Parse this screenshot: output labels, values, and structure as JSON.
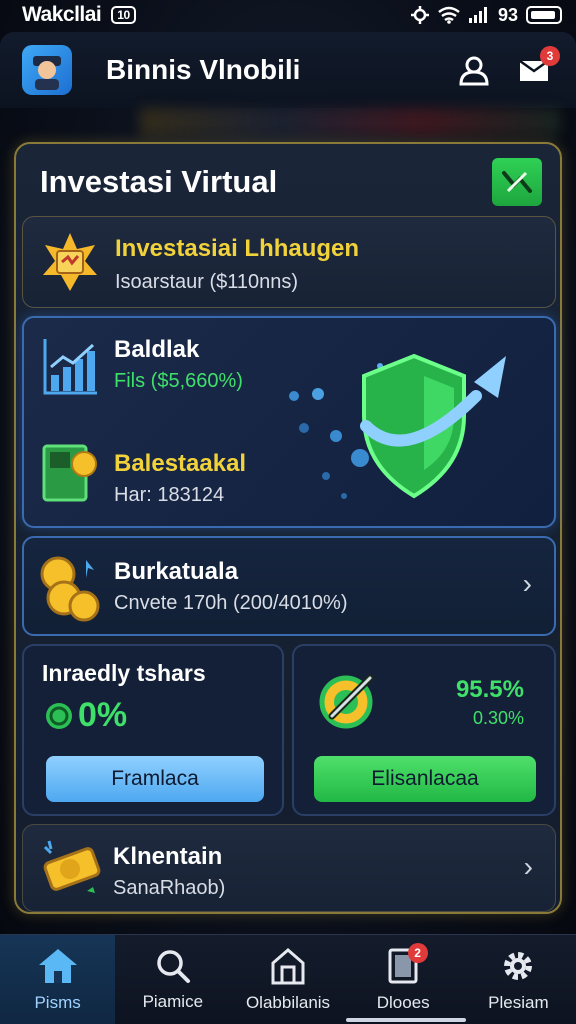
{
  "status": {
    "carrier": "Wakcllai",
    "pill": "10",
    "time": "93",
    "signal": "signal-icon",
    "wifi": "wifi-icon"
  },
  "header": {
    "title": "Binnis Vlnobili",
    "notification_count": "3"
  },
  "panel": {
    "title": "Investasi Virtual",
    "cards": {
      "info": {
        "title": "Investasiai Lhhaugen",
        "subtitle": "Isoarstaur ($110nns)"
      },
      "balance": {
        "title": "Baldlak",
        "value": "Fils ($5,660%)",
        "title2": "Balestaakal",
        "value2": "Har: 183124"
      },
      "earnings": {
        "title": "Burkatuala",
        "subtitle": "Cnvete 170h (200/4010%)"
      },
      "stats": {
        "title": "Inraedly tshars",
        "percent": "0%",
        "button": "Framlaca"
      },
      "growth": {
        "percent_main": "95.5%",
        "percent_sub": "0.30%",
        "button": "Elisanlacaa"
      },
      "extra": {
        "title": "Klnentain",
        "subtitle": "SanaRhaob)"
      }
    }
  },
  "nav": [
    {
      "label": "Pisms",
      "icon": "home-icon"
    },
    {
      "label": "Piamice",
      "icon": "search-icon"
    },
    {
      "label": "Olabbilanis",
      "icon": "house-outline-icon"
    },
    {
      "label": "Dlooes",
      "icon": "document-icon",
      "badge": "2"
    },
    {
      "label": "Plesiam",
      "icon": "gear-icon"
    }
  ],
  "colors": {
    "accent_yellow": "#f2d23a",
    "accent_green": "#3fe06a",
    "accent_blue": "#4ea8f0",
    "badge_red": "#e13a3a"
  }
}
